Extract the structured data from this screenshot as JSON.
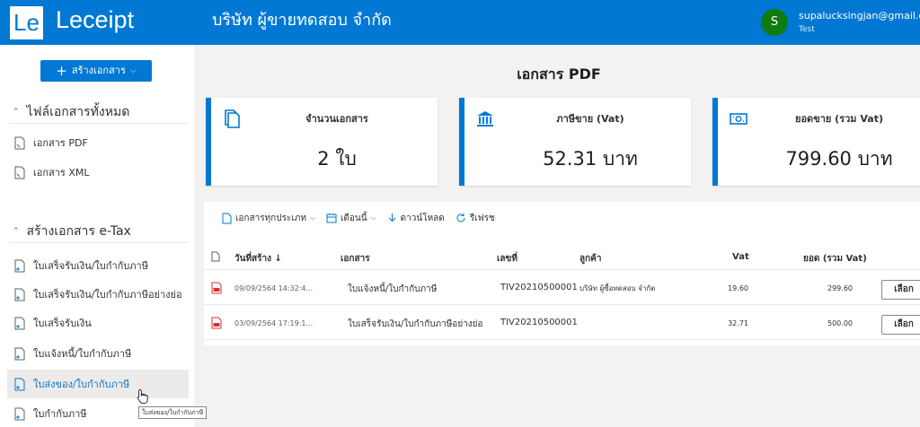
{
  "header": {
    "logo_mark": "Le",
    "app_name": "Leceipt",
    "company": "บริษัท ผู้ขายทดสอบ จำกัด",
    "avatar_initial": "S",
    "user_email": "supalucksingjan@gmail.com",
    "user_role": "Test"
  },
  "sidebar": {
    "create_button": "สร้างเอกสาร",
    "groups": [
      {
        "title": "ไฟล์เอกสารทั้งหมด",
        "items": [
          "เอกสาร PDF",
          "เอกสาร XML"
        ]
      },
      {
        "title": "สร้างเอกสาร e-Tax",
        "items": [
          "ใบเสร็จรับเงิน/ใบกำกับภาษี",
          "ใบเสร็จรับเงิน/ใบกำกับภาษีอย่างย่อ",
          "ใบเสร็จรับเงิน",
          "ใบแจ้งหนี้/ใบกำกับภาษี",
          "ใบส่งของ/ใบกำกับภาษี",
          "ใบกำกับภาษี"
        ]
      }
    ],
    "tooltip": "ใบส่งของ/ใบกำกับภาษี"
  },
  "main": {
    "title": "เอกสาร PDF",
    "cards": [
      {
        "label": "จำนวนเอกสาร",
        "value": "2 ใบ",
        "icon": "documents-icon"
      },
      {
        "label": "ภาษีขาย (Vat)",
        "value": "52.31 บาท",
        "icon": "bank-icon"
      },
      {
        "label": "ยอดขาย (รวม Vat)",
        "value": "799.60 บาท",
        "icon": "money-icon"
      }
    ],
    "toolbar": {
      "doc_type": "เอกสารทุกประเภท",
      "period": "เดือนนี้",
      "download": "ดาวน์โหลด",
      "refresh": "รีเฟรช"
    },
    "table": {
      "columns": [
        "วันที่สร้าง ↓",
        "เอกสาร",
        "เลขที่",
        "ลูกค้า",
        "Vat",
        "ยอด (รวม Vat)"
      ],
      "rows": [
        {
          "created": "09/09/2564 14:32:4...",
          "document": "ใบแจ้งหนี้/ใบกำกับภาษี",
          "number": "TIV20210500001",
          "customer": "บริษัท ผู้ซื้อทดสอบ จำกัด",
          "vat": "19.60",
          "total": "299.60",
          "action": "เลือก"
        },
        {
          "created": "03/09/2564 17:19:1...",
          "document": "ใบเสร็จรับเงิน/ใบกำกับภาษีอย่างย่อ",
          "number": "TIV20210500001",
          "customer": "",
          "vat": "32.71",
          "total": "500.00",
          "action": "เลือก"
        }
      ]
    }
  },
  "colors": {
    "brand": "#0078d4",
    "avatar": "#107c10",
    "pdf": "#d13438"
  }
}
